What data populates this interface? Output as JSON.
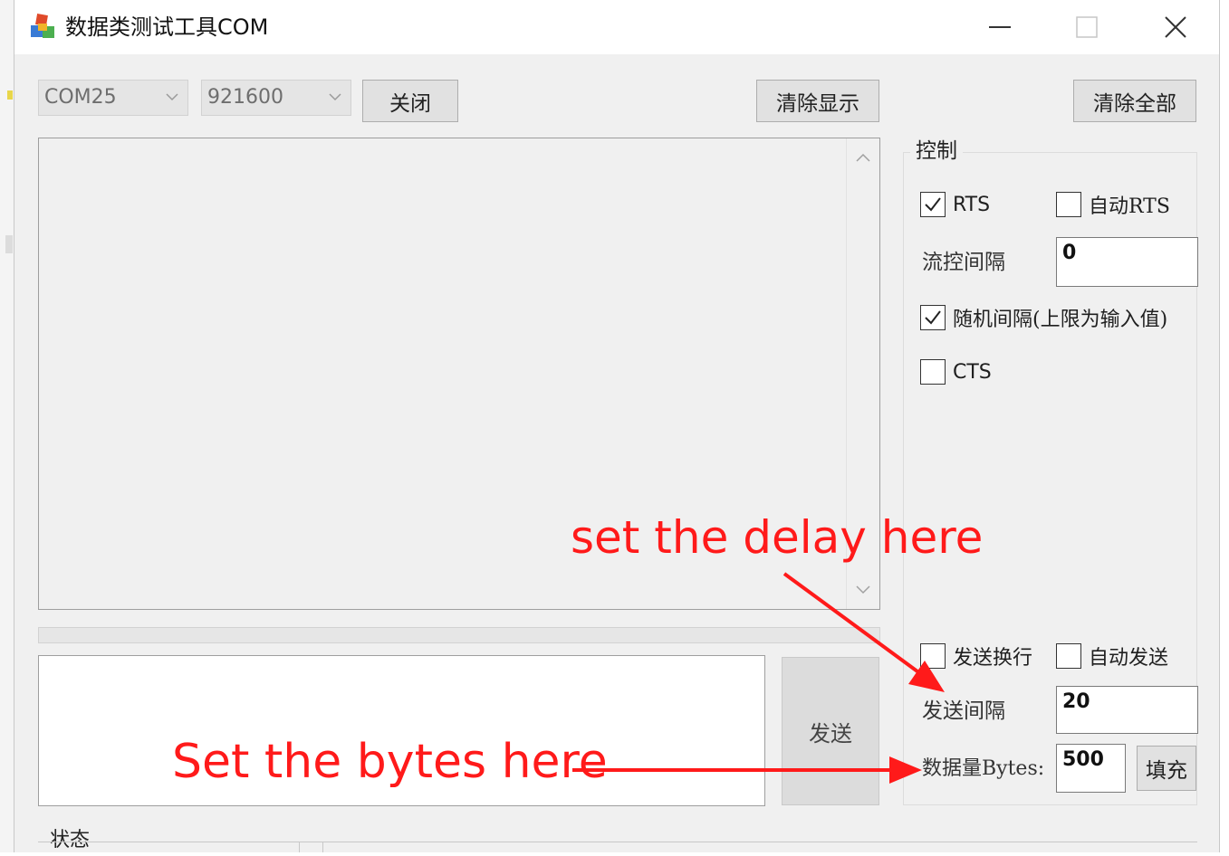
{
  "window": {
    "title": "数据类测试工具COM",
    "minimize_icon": "minimize-icon",
    "maximize_icon": "maximize-icon",
    "close_icon": "close-icon"
  },
  "toolbar": {
    "port_value": "COM25",
    "baud_value": "921600",
    "close_label": "关闭",
    "clear_display_label": "清除显示",
    "clear_all_label": "清除全部"
  },
  "control": {
    "title": "控制",
    "rts_label": "RTS",
    "rts_checked": true,
    "auto_rts_label": "自动RTS",
    "auto_rts_checked": false,
    "flow_interval_label": "流控间隔",
    "flow_interval_value": "0",
    "random_interval_label": "随机间隔(上限为输入值)",
    "random_interval_checked": true,
    "cts_label": "CTS",
    "cts_checked": false,
    "send_newline_label": "发送换行",
    "send_newline_checked": false,
    "auto_send_label": "自动发送",
    "auto_send_checked": false,
    "send_interval_label": "发送间隔",
    "send_interval_value": "20",
    "data_bytes_label": "数据量Bytes:",
    "data_bytes_value": "500",
    "fill_label": "填充"
  },
  "send": {
    "send_label": "发送"
  },
  "status": {
    "label": "状态"
  },
  "annotations": {
    "delay_note": "set the delay here",
    "bytes_note": "Set the bytes here",
    "color": "#ff1a1a"
  }
}
